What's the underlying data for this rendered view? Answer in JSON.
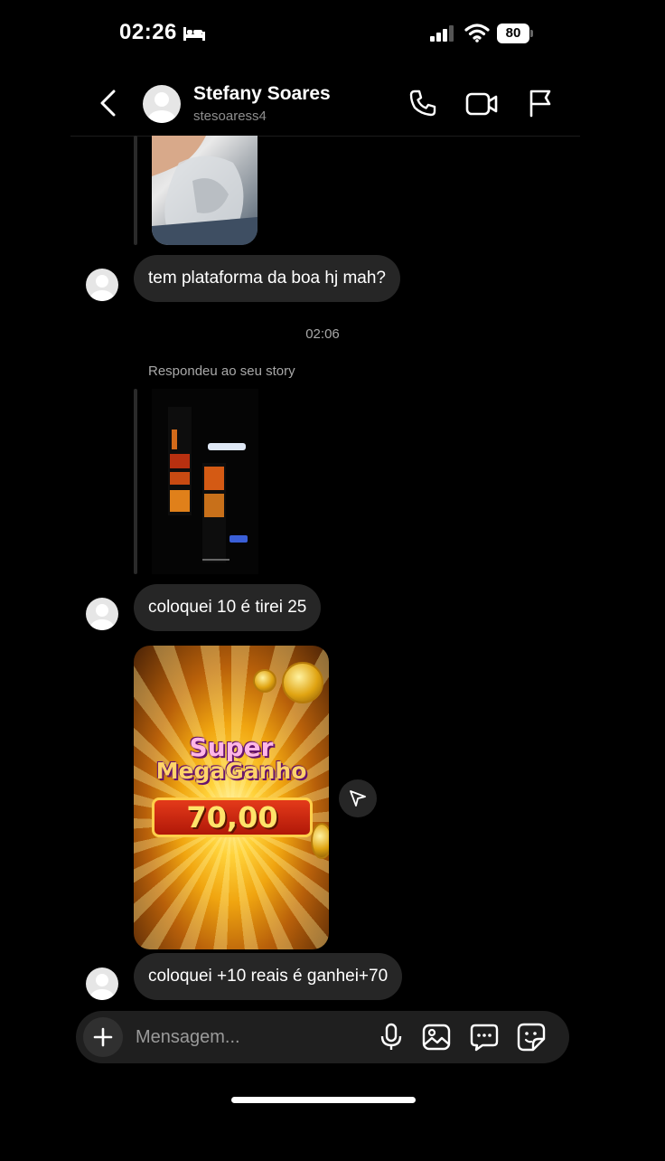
{
  "status_bar": {
    "time": "02:26",
    "battery": "80",
    "icons": [
      "bed-icon",
      "signal-icon",
      "wifi-icon",
      "battery-icon"
    ]
  },
  "header": {
    "name": "Stefany Soares",
    "username": "stesoaress4",
    "icons": [
      "back-chevron-icon",
      "phone-icon",
      "video-camera-icon",
      "flag-icon"
    ]
  },
  "messages": [
    {
      "type": "image",
      "description_icon": "photo-thumbnail"
    },
    {
      "type": "text",
      "text": "tem plataforma da boa hj mah?"
    },
    {
      "type": "timestamp",
      "text": "02:06"
    },
    {
      "type": "story_reply_label",
      "text": "Respondeu ao seu story"
    },
    {
      "type": "story_thumbnail"
    },
    {
      "type": "text",
      "text": "coloquei 10 é tirei 25"
    },
    {
      "type": "image",
      "game": {
        "title_line1": "Super",
        "title_line2": "MegaGanho",
        "amount": "70,00"
      }
    },
    {
      "type": "text",
      "text": "coloquei +10 reais é ganhei+70"
    }
  ],
  "composer": {
    "placeholder": "Mensagem...",
    "icons": [
      "plus-icon",
      "microphone-icon",
      "gallery-icon",
      "chat-bubble-icon",
      "sticker-icon"
    ]
  },
  "colors": {
    "background": "#000000",
    "bubble": "#262626",
    "muted_text": "#a8a8a8",
    "composer": "#1f1f1f"
  }
}
